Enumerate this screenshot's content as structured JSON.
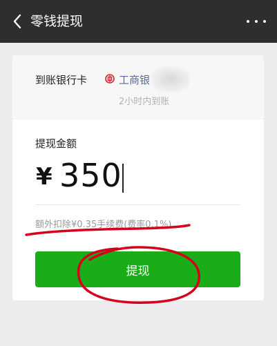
{
  "header": {
    "title": "零钱提现"
  },
  "bank": {
    "label": "到账银行卡",
    "bank_name": "工商银",
    "arrival_note": "2小时内到账"
  },
  "amount": {
    "label": "提现金额",
    "currency": "¥",
    "value": "350",
    "fee_note": "额外扣除¥0.35手续费(费率0.1%)"
  },
  "actions": {
    "withdraw_label": "提现"
  },
  "colors": {
    "nav_bg": "#2e2e2e",
    "accent_green": "#1aad19",
    "bank_icon_red": "#d9252e",
    "annotation_red": "#d6001c"
  }
}
